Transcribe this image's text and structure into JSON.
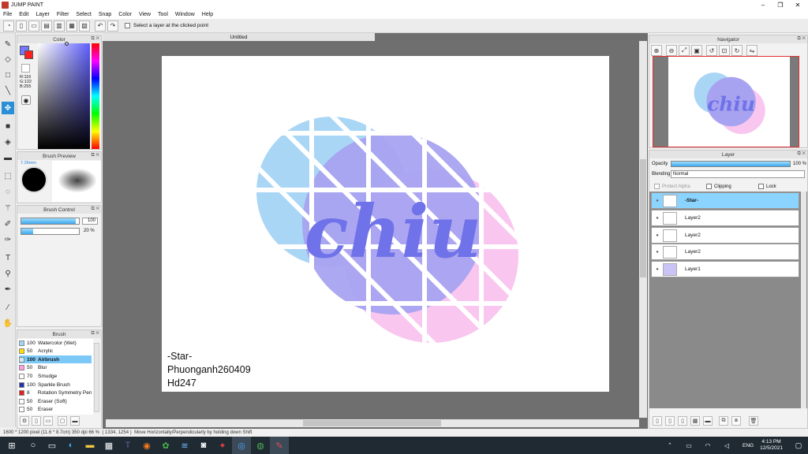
{
  "titlebar": {
    "title": "JUMP PAINT",
    "minimize": "–",
    "maximize": "❐",
    "close": "✕"
  },
  "menu": [
    "File",
    "Edit",
    "Layer",
    "Filter",
    "Select",
    "Snap",
    "Color",
    "View",
    "Tool",
    "Window",
    "Help"
  ],
  "toolbar": {
    "select_layer_label": "Select a layer at the clicked point"
  },
  "color_panel": {
    "title": "Color",
    "rgb": [
      "R:116",
      "G:122",
      "B:255"
    ],
    "fg_color": "#7478ff",
    "bg_color": "#ff2020"
  },
  "brush_preview": {
    "title": "Brush Preview",
    "size_label": "7.26mm"
  },
  "brush_control": {
    "title": "Brush Control",
    "size_value": "100",
    "density_value": "20 %",
    "size_level": 0.95,
    "density_level": 0.2
  },
  "brush_panel": {
    "title": "Brush",
    "items": [
      {
        "size": "100",
        "name": "Watercolor (Wet)",
        "color": "#9fd8f7"
      },
      {
        "size": "50",
        "name": "Acrylic",
        "color": "#ffe000"
      },
      {
        "size": "100",
        "name": "Airbrush",
        "color": "#c8ecfc"
      },
      {
        "size": "50",
        "name": "Blur",
        "color": "#ff9ee0"
      },
      {
        "size": "70",
        "name": "Smudge",
        "color": "#ffffff"
      },
      {
        "size": "100",
        "name": "Sparkle Brush",
        "color": "#2233aa"
      },
      {
        "size": "8",
        "name": "Rotation Symmetry Pen",
        "color": "#dd2222"
      },
      {
        "size": "50",
        "name": "Eraser (Soft)",
        "color": "#ffffff"
      },
      {
        "size": "50",
        "name": "Eraser",
        "color": "#ffffff"
      }
    ],
    "selected": 2
  },
  "document": {
    "tab_title": "Untitled"
  },
  "canvas_art": {
    "word": "chiu",
    "credits": [
      "-Star-",
      "Phuonganh260409",
      "Hd247"
    ],
    "colors": {
      "blue": "#a9d6f5",
      "purple": "#a8a3f0",
      "pink": "#f9c6ef",
      "text": "#6f72e8"
    }
  },
  "navigator": {
    "title": "Navigator"
  },
  "layer_panel": {
    "title": "Layer",
    "opacity_label": "Opacity",
    "opacity_value": "100 %",
    "blending_label": "Blending",
    "blending_value": "Normal",
    "protect_alpha": "Protect Alpha",
    "clipping": "Clipping",
    "lock": "Lock",
    "layers": [
      "-Star-",
      "Layer2",
      "Layer2",
      "Layer2",
      "Layer1"
    ],
    "selected_layer": 0
  },
  "statusbar": {
    "size": "1600 * 1200 pixel",
    "physical": "(11.6 * 8.7cm)",
    "dpi": "350 dpi",
    "zoom": "66 %",
    "coords": "( 1334, 1254 )",
    "hint": "Move Horizontally/Perpendicularly by holding down Shift"
  },
  "taskbar": {
    "lang": "ENG",
    "time": "4:13 PM",
    "date": "12/5/2021"
  }
}
